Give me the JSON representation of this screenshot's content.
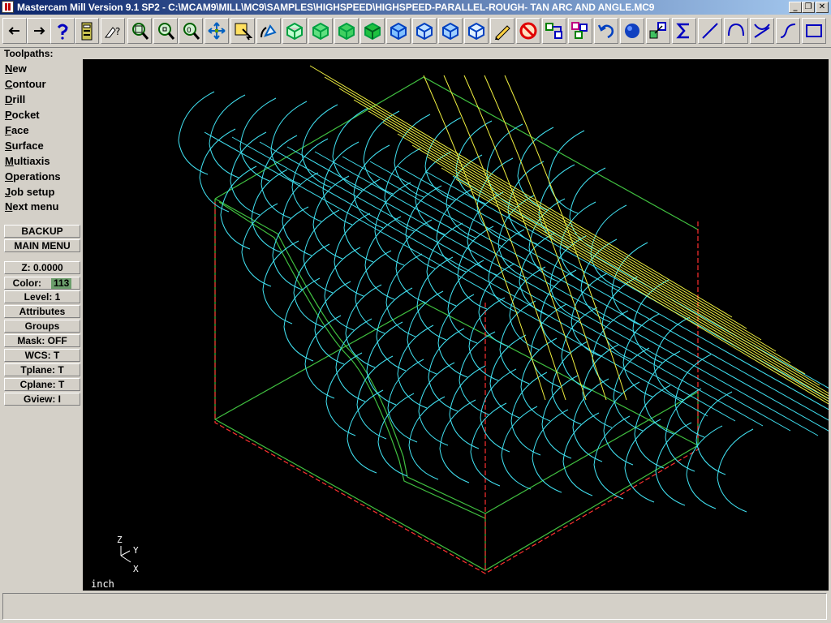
{
  "window": {
    "title": "Mastercam Mill Version 9.1 SP2 - C:\\MCAM9\\MILL\\MC9\\SAMPLES\\HIGHSPEED\\HIGHSPEED-PARALLEL-ROUGH- TAN ARC AND ANGLE.MC9",
    "minimize_glyph": "_",
    "restore_glyph": "❐",
    "close_glyph": "✕"
  },
  "toolbar": {
    "buttons": [
      {
        "name": "back-arrow-icon"
      },
      {
        "name": "forward-arrow-icon"
      },
      {
        "name": "help-icon"
      },
      {
        "name": "calculator-icon"
      },
      {
        "name": "analyze-icon"
      },
      {
        "name": "zoom-window-icon"
      },
      {
        "name": "unzoom-icon"
      },
      {
        "name": "zoom-fit-icon"
      },
      {
        "name": "pan-icon"
      },
      {
        "name": "select-icon"
      },
      {
        "name": "rotate-icon"
      },
      {
        "name": "iso-view-icon"
      },
      {
        "name": "top-view-icon"
      },
      {
        "name": "front-view-icon"
      },
      {
        "name": "side-view-icon"
      },
      {
        "name": "cube-view-1-icon"
      },
      {
        "name": "cube-view-2-icon"
      },
      {
        "name": "cube-view-3-icon"
      },
      {
        "name": "cube-view-4-icon"
      },
      {
        "name": "pencil-icon"
      },
      {
        "name": "no-delete-icon"
      },
      {
        "name": "xform-translate-icon"
      },
      {
        "name": "xform-rotate-icon"
      },
      {
        "name": "undo-icon"
      },
      {
        "name": "shade-sphere-icon"
      },
      {
        "name": "xform-scale-icon"
      },
      {
        "name": "sum-icon"
      },
      {
        "name": "line-icon"
      },
      {
        "name": "arc-icon"
      },
      {
        "name": "trim-icon"
      },
      {
        "name": "spline-icon"
      },
      {
        "name": "rectangle-icon"
      }
    ]
  },
  "section_label": "Toolpaths:",
  "menu": {
    "items": [
      {
        "hot": "N",
        "rest": "ew"
      },
      {
        "hot": "C",
        "rest": "ontour"
      },
      {
        "hot": "D",
        "rest": "rill"
      },
      {
        "hot": "P",
        "rest": "ocket"
      },
      {
        "hot": "F",
        "rest": "ace"
      },
      {
        "hot": "S",
        "rest": "urface"
      },
      {
        "hot": "M",
        "rest": "ultiaxis"
      },
      {
        "hot": "O",
        "rest": "perations"
      },
      {
        "hot": "J",
        "rest": "ob setup"
      },
      {
        "hot": "N",
        "rest": "ext menu"
      }
    ],
    "backup": "BACKUP",
    "main_menu": "MAIN MENU"
  },
  "params": {
    "z": "Z:  0.0000",
    "color_label": "Color:",
    "color_value": "113",
    "level": "Level:  1",
    "attributes": "Attributes",
    "groups": "Groups",
    "mask": "Mask:  OFF",
    "wcs": "WCS:   T",
    "tplane": "Tplane:  T",
    "cplane": "Cplane:  T",
    "gview": "Gview:   I"
  },
  "viewport": {
    "unit": "inch",
    "axis_z": "Z",
    "axis_y": "Y",
    "axis_x": "X",
    "colors": {
      "background": "#000000",
      "toolpath_arcs": "#40e0f0",
      "toolpath_lines": "#f0f040",
      "part_edges": "#40c040",
      "construction": "#ff3030"
    }
  },
  "status_text": ""
}
